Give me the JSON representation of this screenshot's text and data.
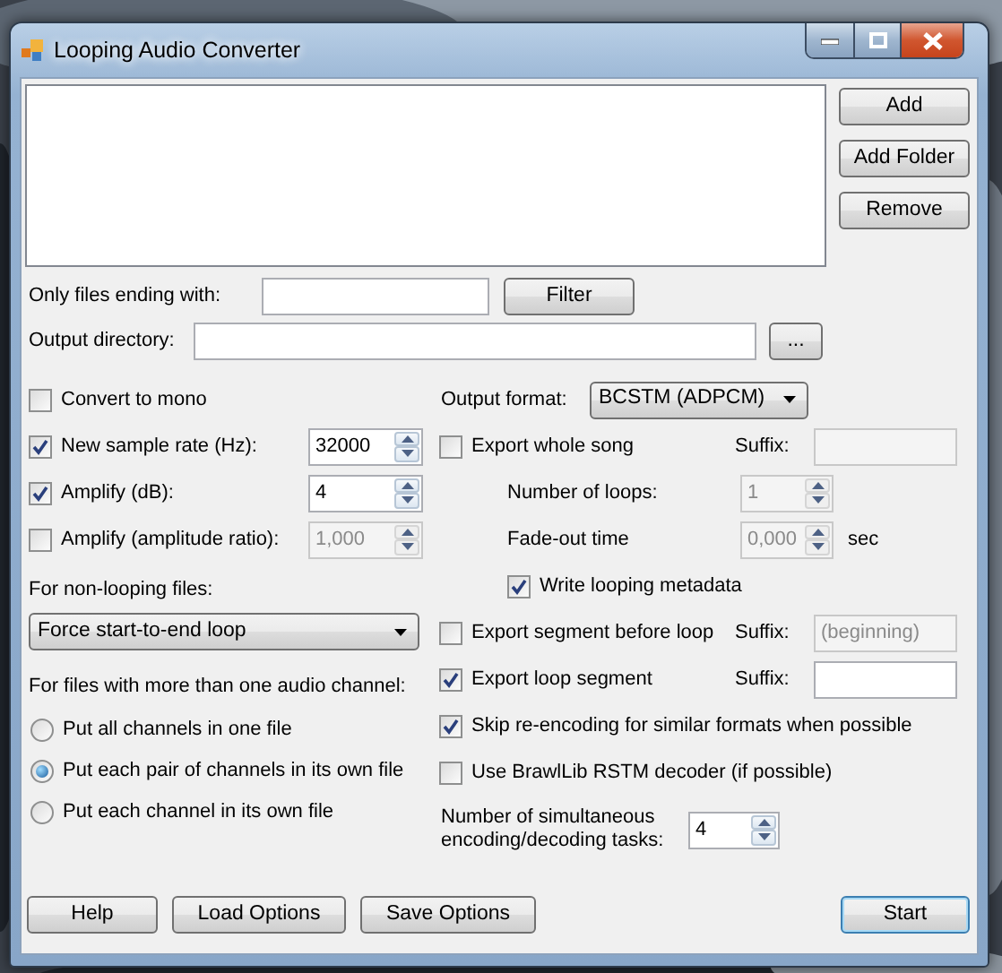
{
  "window": {
    "title": "Looping Audio Converter"
  },
  "side_buttons": [
    {
      "label": "Add"
    },
    {
      "label": "Add Folder"
    },
    {
      "label": "Remove"
    }
  ],
  "filter": {
    "label": "Only files ending with:",
    "button": "Filter"
  },
  "output_directory": {
    "label": "Output directory:",
    "button": "..."
  },
  "left_options": [
    {
      "label": "Convert to mono",
      "checked": false
    },
    {
      "label": "New sample rate (Hz):",
      "checked": true,
      "spin": {
        "value": "32000",
        "disabled": false
      }
    },
    {
      "label": "Amplify (dB):",
      "checked": true,
      "spin": {
        "value": "4",
        "disabled": false
      }
    },
    {
      "label": "Amplify (amplitude ratio):",
      "checked": false,
      "spin": {
        "value": "1,000",
        "disabled": true
      }
    }
  ],
  "non_looping": {
    "label": "For non-looping files:",
    "value": "Force start-to-end loop"
  },
  "channels": {
    "label": "For files with more than one audio channel:",
    "options": [
      {
        "label": "Put all channels in one file",
        "selected": false
      },
      {
        "label": "Put each pair of channels in its own file",
        "selected": true
      },
      {
        "label": "Put each channel in its own file",
        "selected": false
      }
    ]
  },
  "output_format": {
    "label": "Output format:",
    "value": "BCSTM (ADPCM)"
  },
  "right_options": [
    {
      "kind": "checkbox",
      "label": "Export whole song",
      "checked": false,
      "suffix": {
        "label": "Suffix:",
        "disabled": true
      }
    },
    {
      "kind": "spin",
      "label": "Number of loops:",
      "value": "1",
      "disabled": true
    },
    {
      "kind": "spin",
      "label": "Fade-out time",
      "value": "0,000",
      "disabled": true,
      "unit": "sec"
    },
    {
      "kind": "subcheck",
      "label": "Write looping metadata",
      "checked": true
    },
    {
      "kind": "checkbox",
      "label": "Export segment before loop",
      "checked": false,
      "suffix": {
        "label": "Suffix:",
        "value": "(beginning)",
        "disabled": true
      }
    },
    {
      "kind": "checkbox",
      "label": "Export loop segment",
      "checked": true,
      "suffix": {
        "label": "Suffix:",
        "disabled": false
      }
    },
    {
      "kind": "checkbox",
      "label": "Skip re-encoding for similar formats when possible",
      "checked": true
    },
    {
      "kind": "checkbox",
      "label": "Use BrawlLib RSTM decoder (if possible)",
      "checked": false
    },
    {
      "kind": "tasks",
      "label": "Number of simultaneous encoding/decoding tasks:",
      "value": "4",
      "disabled": false
    }
  ],
  "bottom_buttons": [
    {
      "label": "Help",
      "focused": false
    },
    {
      "label": "Load Options",
      "focused": false
    },
    {
      "label": "Save Options",
      "focused": false
    }
  ],
  "start_button": {
    "label": "Start",
    "focused": true
  }
}
